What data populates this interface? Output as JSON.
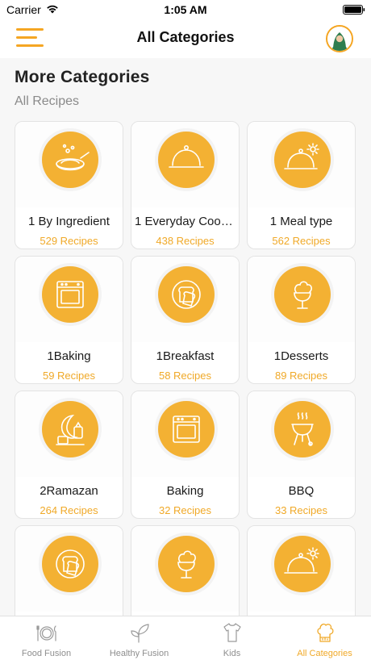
{
  "status_bar": {
    "carrier": "Carrier",
    "time": "1:05 AM"
  },
  "nav": {
    "title": "All Categories"
  },
  "section": {
    "title": "More Categories",
    "subtitle": "All Recipes"
  },
  "colors": {
    "accent": "#f3b133",
    "accent_text": "#f0a928"
  },
  "categories": [
    {
      "name": "1 By Ingredient",
      "count": "529 Recipes",
      "icon": "bowl-icon"
    },
    {
      "name": "1 Everyday Cook...",
      "count": "438 Recipes",
      "icon": "cloche-icon"
    },
    {
      "name": "1 Meal type",
      "count": "562 Recipes",
      "icon": "cloche-sparkle-icon"
    },
    {
      "name": "1Baking",
      "count": "59 Recipes",
      "icon": "oven-icon"
    },
    {
      "name": "1Breakfast",
      "count": "58 Recipes",
      "icon": "toast-plate-icon"
    },
    {
      "name": "1Desserts",
      "count": "89 Recipes",
      "icon": "ice-cream-cup-icon"
    },
    {
      "name": "2Ramazan",
      "count": "264 Recipes",
      "icon": "crescent-lantern-icon"
    },
    {
      "name": "Baking",
      "count": "32 Recipes",
      "icon": "oven-icon"
    },
    {
      "name": "BBQ",
      "count": "33 Recipes",
      "icon": "bbq-grill-icon"
    },
    {
      "name": "",
      "count": "",
      "icon": "toast-plate-icon"
    },
    {
      "name": "",
      "count": "",
      "icon": "ice-cream-cup-icon"
    },
    {
      "name": "",
      "count": "",
      "icon": "cloche-sparkle-icon"
    }
  ],
  "tabs": [
    {
      "label": "Food Fusion",
      "icon": "plate-cutlery-icon",
      "active": false
    },
    {
      "label": "Healthy Fusion",
      "icon": "sprout-icon",
      "active": false
    },
    {
      "label": "Kids",
      "icon": "kids-shirt-icon",
      "active": false
    },
    {
      "label": "All Categories",
      "icon": "chef-hat-icon",
      "active": true
    }
  ]
}
